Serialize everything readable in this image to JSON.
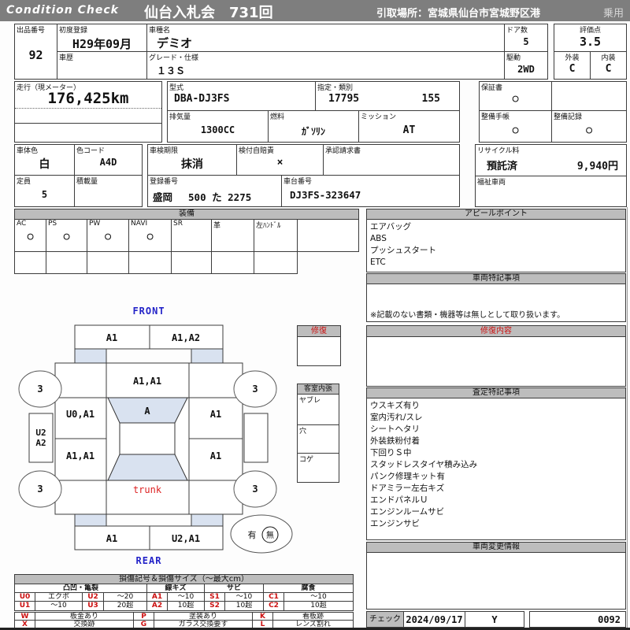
{
  "header": {
    "brand": "Condition  Check",
    "auction_title": "仙台入札会　731回",
    "pickup_location": "引取場所：宮城県仙台市宮城野区港",
    "vehicle_class": "乗用"
  },
  "fields": {
    "lot": {
      "label": "出品番号",
      "value": "92"
    },
    "first_registration": {
      "label": "初度登録",
      "value": "H29年09月"
    },
    "history": {
      "label": "車歴",
      "value": ""
    },
    "model": {
      "label": "車種名",
      "value": "デミオ"
    },
    "grade": {
      "label": "グレード・仕様",
      "value": "１３Ｓ"
    },
    "doors": {
      "label": "ドア数",
      "value": "5"
    },
    "drive": {
      "label": "駆動",
      "value": "2WD"
    },
    "score": {
      "label": "評価点",
      "value": "3.5"
    },
    "exterior": {
      "label": "外装",
      "value": "C"
    },
    "interior": {
      "label": "内装",
      "value": "C"
    },
    "mileage": {
      "label": "走行（現メーター）",
      "value": "176,425km"
    },
    "model_code": {
      "label": "型式",
      "value": "DBA-DJ3FS"
    },
    "designation": {
      "label": "指定・類別",
      "value1": "17795",
      "value2": "155"
    },
    "displacement": {
      "label": "排気量",
      "value": "1300CC"
    },
    "fuel": {
      "label": "燃料",
      "value": "ｶﾞｿﾘﾝ"
    },
    "transmission": {
      "label": "ミッション",
      "value": "AT"
    },
    "warranty": {
      "label": "保証書",
      "value": "○"
    },
    "maintenance_book": {
      "label": "整備手帳",
      "value": "○"
    },
    "maintenance_record": {
      "label": "整備記録",
      "value": "○"
    },
    "body_color": {
      "label": "車体色",
      "value": "白"
    },
    "color_code": {
      "label": "色コード",
      "value": "A4D"
    },
    "inspection_expiry": {
      "label": "車検期限",
      "value": "抹消"
    },
    "insurance": {
      "label": "検付自賠責",
      "value": "×"
    },
    "approval_request": {
      "label": "承認請求書",
      "value": ""
    },
    "capacity": {
      "label": "定員",
      "value": "5"
    },
    "load_capacity": {
      "label": "積載量",
      "value": ""
    },
    "plate_number": {
      "label": "登録番号",
      "value": "盛岡　 500 た  2275"
    },
    "chassis_number": {
      "label": "車台番号",
      "value": "DJ3FS-323647"
    },
    "recycle": {
      "label": "リサイクル料",
      "status": "預託済",
      "fee": "9,940円"
    },
    "welfare": {
      "label": "福祉車両",
      "value": ""
    }
  },
  "equipment": {
    "title": "装備",
    "items": [
      {
        "label": "AC",
        "value": "○"
      },
      {
        "label": "PS",
        "value": "○"
      },
      {
        "label": "PW",
        "value": "○"
      },
      {
        "label": "NAVI",
        "value": "○"
      },
      {
        "label": "SR",
        "value": ""
      },
      {
        "label": "革",
        "value": ""
      },
      {
        "label": "左ﾊﾝﾄﾞﾙ",
        "value": ""
      },
      {
        "label": "",
        "value": ""
      }
    ]
  },
  "appeal_points": {
    "title": "アピールポイント",
    "items": [
      "エアバッグ",
      "ABS",
      "プッシュスタート",
      "ETC"
    ]
  },
  "vehicle_notes": {
    "title": "車両特記事項",
    "disclaimer": "※記載のない書類・機器等は無しとして取り扱います。"
  },
  "repair_content": {
    "title": "修復内容"
  },
  "assessment_notes": {
    "title": "査定特記事項",
    "items": [
      "ウスキズ有り",
      "室内汚れ/スレ",
      "シートヘタリ",
      "外装鉄粉付着",
      "下回りＳ中",
      "スタッドレスタイヤ積み込み",
      "パンク修理キット有",
      "ドアミラー左右キズ",
      "エンドパネルＵ",
      "エンジンルームサビ",
      "エンジンサビ"
    ]
  },
  "change_info": {
    "title": "車両変更情報"
  },
  "check": {
    "label": "チェック",
    "date": "2024/09/17",
    "inspector": "Y",
    "sheet_number": "0092"
  },
  "diagram": {
    "front_label": "FRONT",
    "rear_label": "REAR",
    "trunk_label": "trunk",
    "repair_box_title": "修復",
    "interior_box": {
      "title": "客室内張",
      "rows": [
        "ヤブレ",
        "穴",
        "コゲ"
      ]
    },
    "presence_mark": {
      "yes": "有",
      "no": "無"
    },
    "marks": {
      "front_bumper_left": "A1",
      "front_bumper_right": "A1,A2",
      "hood": "A1,A1",
      "windshield": "A",
      "left_front_door": "U0,A1",
      "left_rear_door": "A1,A1",
      "right_front_door": "A1",
      "right_rear_door": "A1",
      "left_side_line1": "U2",
      "left_side_line2": "A2",
      "rear_bumper_left": "A1",
      "rear_bumper_right": "U2,A1",
      "wheel_front_left": "3",
      "wheel_front_right": "3",
      "wheel_rear_left": "3",
      "wheel_rear_right": "3"
    }
  },
  "legend": {
    "title": "損傷記号＆損傷サイズ（～最大cm）",
    "groups": [
      "凸凹・亀裂",
      "線キズ",
      "サビ",
      "腐食"
    ],
    "dent_rows": [
      [
        "U0",
        "エクボ",
        "U2",
        "～20"
      ],
      [
        "U1",
        "～10",
        "U3",
        "20超"
      ]
    ],
    "scratch_rows": [
      [
        "A1",
        "～10"
      ],
      [
        "A2",
        "10超"
      ]
    ],
    "rust_rows": [
      [
        "S1",
        "～10"
      ],
      [
        "S2",
        "10超"
      ]
    ],
    "corrosion_rows": [
      [
        "C1",
        "～10"
      ],
      [
        "C2",
        "10超"
      ]
    ],
    "code_rows": [
      [
        {
          "code": "W",
          "label": "板金あり"
        },
        {
          "code": "P",
          "label": "塗装あり"
        },
        {
          "code": "K",
          "label": "看板跡"
        }
      ],
      [
        {
          "code": "X",
          "label": "交換跡"
        },
        {
          "code": "G",
          "label": "ガラス交換要す"
        },
        {
          "code": "L",
          "label": "レンズ割れ"
        }
      ]
    ]
  },
  "colors": {
    "header_bg": "#7e7e7e",
    "section_header_bg": "#bdbdbd",
    "glass_fill": "#d9e2f0",
    "accent_red": "#cc1111",
    "accent_blue": "#2323c8"
  }
}
